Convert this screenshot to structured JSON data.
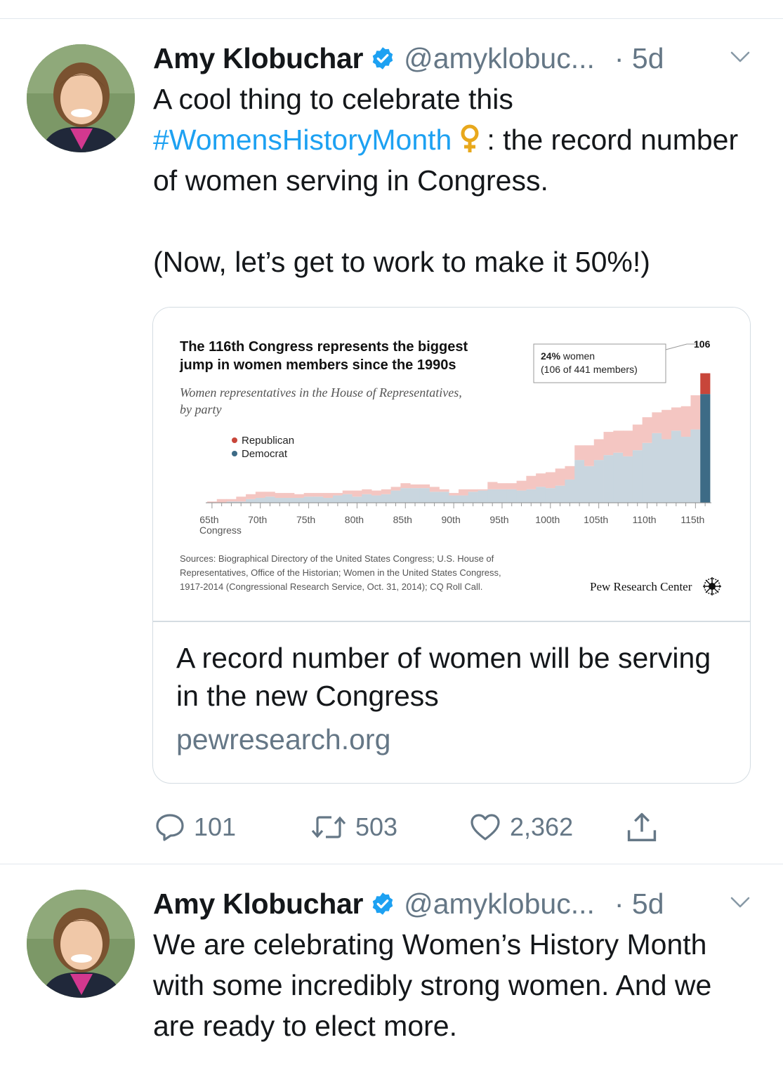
{
  "tweets": [
    {
      "name": "Amy Klobuchar",
      "handle": "@amyklobuc...",
      "time": "· 5d",
      "text_before": "A cool thing to celebrate this ",
      "hashtag": "#WomensHistoryMonth",
      "emoji": "♀",
      "text_after": ": the record number of women serving in Congress.\n\n(Now, let’s get to work to make it 50%!)",
      "card": {
        "title": "A record number of women will be serving in the new Congress",
        "domain": "pewresearch.org"
      },
      "actions": {
        "replies": "101",
        "retweets": "503",
        "likes": "2,362"
      }
    },
    {
      "name": "Amy Klobuchar",
      "handle": "@amyklobuc...",
      "time": "· 5d",
      "text": "We are celebrating Women’s History Month with some incredibly strong women. And we are ready to elect more."
    }
  ],
  "colors": {
    "link_blue": "#1da1f2",
    "secondary_text": "#657786",
    "republican": "#c8463a",
    "democrat": "#3d6b86",
    "republican_area": "#f4c6c2",
    "democrat_area": "#c9d6df"
  },
  "icons": [
    "verified-badge-icon",
    "caret-down-icon",
    "reply-icon",
    "retweet-icon",
    "like-icon",
    "share-icon",
    "pew-logo-icon"
  ],
  "chart_data": {
    "type": "area",
    "title": "The 116th Congress represents the biggest jump in women members since the 1990s",
    "subtitle": "Women representatives in the House of Representatives, by party",
    "legend": [
      "Republican",
      "Democrat"
    ],
    "legend_placement": "top-left",
    "xlabel": "Congress",
    "x_tick_labels": [
      "65th",
      "70th",
      "75th",
      "80th",
      "85th",
      "90th",
      "95th",
      "100th",
      "105th",
      "110th",
      "115th"
    ],
    "x": [
      65,
      66,
      67,
      68,
      69,
      70,
      71,
      72,
      73,
      74,
      75,
      76,
      77,
      78,
      79,
      80,
      81,
      82,
      83,
      84,
      85,
      86,
      87,
      88,
      89,
      90,
      91,
      92,
      93,
      94,
      95,
      96,
      97,
      98,
      99,
      100,
      101,
      102,
      103,
      104,
      105,
      106,
      107,
      108,
      109,
      110,
      111,
      112,
      113,
      114,
      115,
      116
    ],
    "series": [
      {
        "name": "Democrat",
        "values": [
          0,
          0,
          1,
          1,
          3,
          4,
          5,
          4,
          4,
          4,
          5,
          5,
          4,
          6,
          7,
          5,
          7,
          6,
          7,
          10,
          12,
          12,
          12,
          9,
          9,
          6,
          6,
          9,
          10,
          11,
          11,
          11,
          10,
          11,
          13,
          12,
          14,
          19,
          35,
          30,
          35,
          39,
          41,
          38,
          43,
          49,
          57,
          52,
          59,
          54,
          60,
          89
        ]
      },
      {
        "name": "Republican",
        "values": [
          1,
          3,
          2,
          4,
          4,
          5,
          4,
          4,
          4,
          3,
          3,
          3,
          4,
          2,
          3,
          5,
          4,
          4,
          4,
          3,
          4,
          3,
          3,
          4,
          2,
          2,
          5,
          2,
          1,
          6,
          5,
          5,
          8,
          11,
          11,
          13,
          14,
          11,
          12,
          17,
          17,
          19,
          18,
          21,
          21,
          21,
          17,
          24,
          19,
          25,
          28,
          17
        ]
      }
    ],
    "totals_approx": {
      "116th": 106
    },
    "annotation": {
      "label": "24% women",
      "detail": "(106 of 441 members)",
      "value_label": "106"
    },
    "source": "Sources: Biographical Directory of the United States Congress; U.S. House of Representatives, Office of the Historian; Women in the United States Congress, 1917-2014 (Congressional Research Service, Oct. 31, 2014); CQ Roll Call.",
    "brand": "Pew Research Center"
  }
}
